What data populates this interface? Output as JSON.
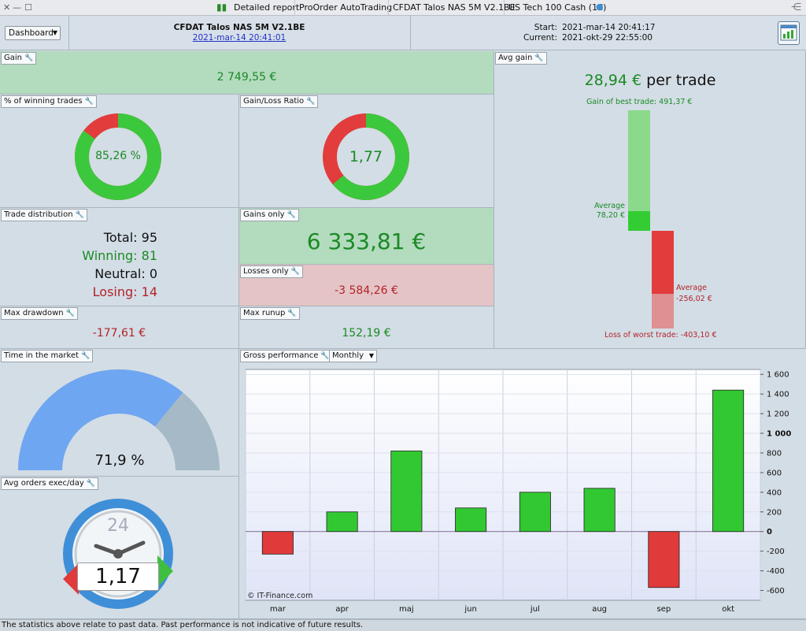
{
  "titlebar": {
    "tabs": [
      "Detailed report",
      "ProOrder AutoTrading",
      "CFDAT Talos NAS 5M V2.1BE",
      "US Tech 100 Cash (1€)"
    ]
  },
  "header": {
    "dashboard_label": "Dashboard",
    "strategy_name": "CFDAT Talos NAS 5M V2.1BE",
    "strategy_date": "2021-mar-14 20:41:01",
    "start_label": "Start:",
    "start_value": "2021-mar-14 20:41:17",
    "current_label": "Current:",
    "current_value": "2021-okt-29 22:55:00"
  },
  "gain": {
    "title": "Gain",
    "value": "2 749,55 €"
  },
  "winning_trades": {
    "title": "% of winning trades",
    "value": "85,26 %",
    "fraction": 0.8526
  },
  "gain_loss_ratio": {
    "title": "Gain/Loss Ratio",
    "value": "1,77",
    "green_fraction": 0.6389
  },
  "avg_gain": {
    "title": "Avg gain",
    "value": "28,94 €",
    "suffix": "per trade",
    "best_label": "Gain of best trade: 491,37 €",
    "avg_win_label": "Average",
    "avg_win_value": "78,20 €",
    "avg_loss_label": "Average",
    "avg_loss_value": "-256,02 €",
    "worst_label": "Loss of worst trade: -403,10 €"
  },
  "trade_distribution": {
    "title": "Trade distribution",
    "total": "Total: 95",
    "winning": "Winning: 81",
    "neutral": "Neutral: 0",
    "losing": "Losing: 14"
  },
  "gains_only": {
    "title": "Gains only",
    "value": "6 333,81 €"
  },
  "losses_only": {
    "title": "Losses only",
    "value": "-3 584,26 €"
  },
  "max_drawdown": {
    "title": "Max drawdown",
    "value": "-177,61 €"
  },
  "max_runup": {
    "title": "Max runup",
    "value": "152,19 €"
  },
  "time_in_market": {
    "title": "Time in the market",
    "value": "71,9 %",
    "fraction": 0.719
  },
  "avg_orders": {
    "title": "Avg orders exec/day",
    "value": "1,17",
    "clock_label": "24"
  },
  "gross_performance": {
    "title": "Gross performance",
    "period": "Monthly",
    "watermark": "© IT-Finance.com"
  },
  "chart_data": {
    "type": "bar",
    "categories": [
      "mar",
      "apr",
      "maj",
      "jun",
      "jul",
      "aug",
      "sep",
      "okt"
    ],
    "values": [
      -230,
      200,
      820,
      240,
      400,
      440,
      -570,
      1440
    ],
    "ylim": [
      -700,
      1650
    ],
    "yticks": [
      -600,
      -400,
      -200,
      0,
      200,
      400,
      600,
      800,
      1000,
      1200,
      1400,
      1600
    ],
    "ytick_labels": [
      "-600",
      "-400",
      "-200",
      "0",
      "200",
      "400",
      "600",
      "800",
      "1 000",
      "1 200",
      "1 400",
      "1 600"
    ],
    "grid": true,
    "positive_color": "#32c832",
    "negative_color": "#e03a3a"
  },
  "colors": {
    "green": "#3cc83c",
    "red": "#e23c3c",
    "gauge_blue": "#6ea6f2",
    "gauge_gray": "#a5b9c6"
  },
  "footer": {
    "text": "The statistics above relate to past data. Past performance is not indicative of future results."
  }
}
